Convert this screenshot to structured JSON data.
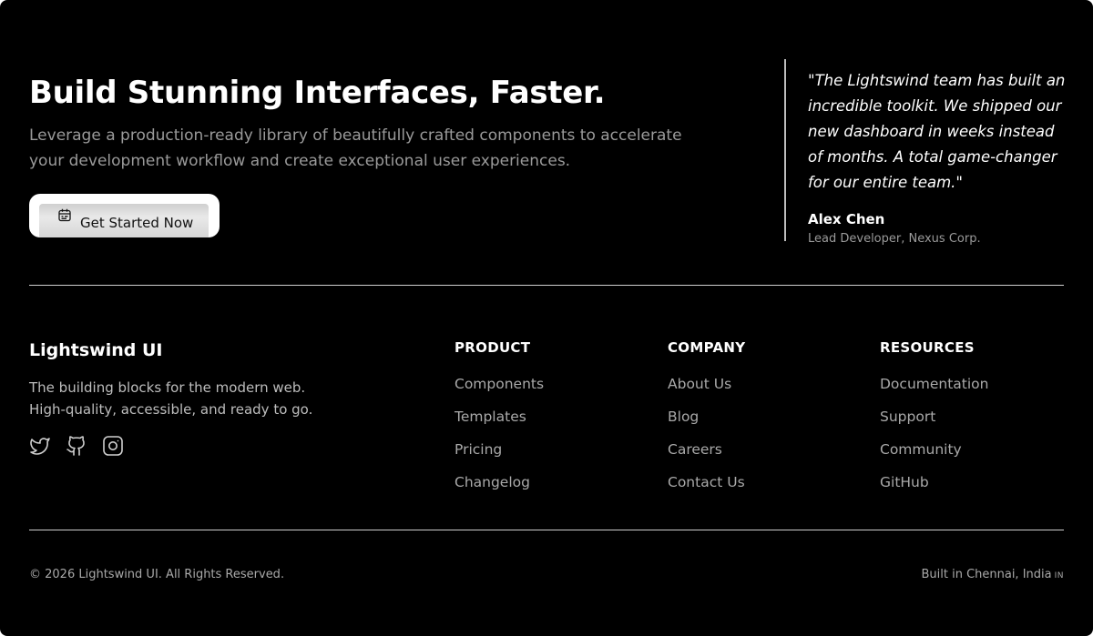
{
  "hero": {
    "title": "Build Stunning Interfaces, Faster.",
    "subtitle": "Leverage a production-ready library of beautifully crafted components to accelerate your development workflow and create exceptional user experiences.",
    "cta": {
      "label": "Get Started Now",
      "icon": "calendar-icon"
    }
  },
  "testimonial": {
    "quote": "\"The Lightswind team has built an incredible toolkit. We shipped our new dashboard in weeks instead of months. A total game-changer for our entire team.\"",
    "author": "Alex Chen",
    "role": "Lead Developer, Nexus Corp."
  },
  "brand": {
    "name": "Lightswind UI",
    "tagline_line1": "The building blocks for the modern web.",
    "tagline_line2": "High-quality, accessible, and ready to go.",
    "social": [
      "twitter-icon",
      "github-icon",
      "instagram-icon"
    ]
  },
  "columns": [
    {
      "title": "PRODUCT",
      "links": [
        "Components",
        "Templates",
        "Pricing",
        "Changelog"
      ]
    },
    {
      "title": "COMPANY",
      "links": [
        "About Us",
        "Blog",
        "Careers",
        "Contact Us"
      ]
    },
    {
      "title": "RESOURCES",
      "links": [
        "Documentation",
        "Support",
        "Community",
        "GitHub"
      ]
    }
  ],
  "footer": {
    "copyright": "© 2026 Lightswind UI. All Rights Reserved.",
    "built_in": "Built in Chennai, India",
    "flag_code": "IN"
  },
  "colors": {
    "background": "#000000",
    "text": "#ffffff",
    "muted": "#a9a9a9",
    "divider": "#cfcfcf"
  }
}
